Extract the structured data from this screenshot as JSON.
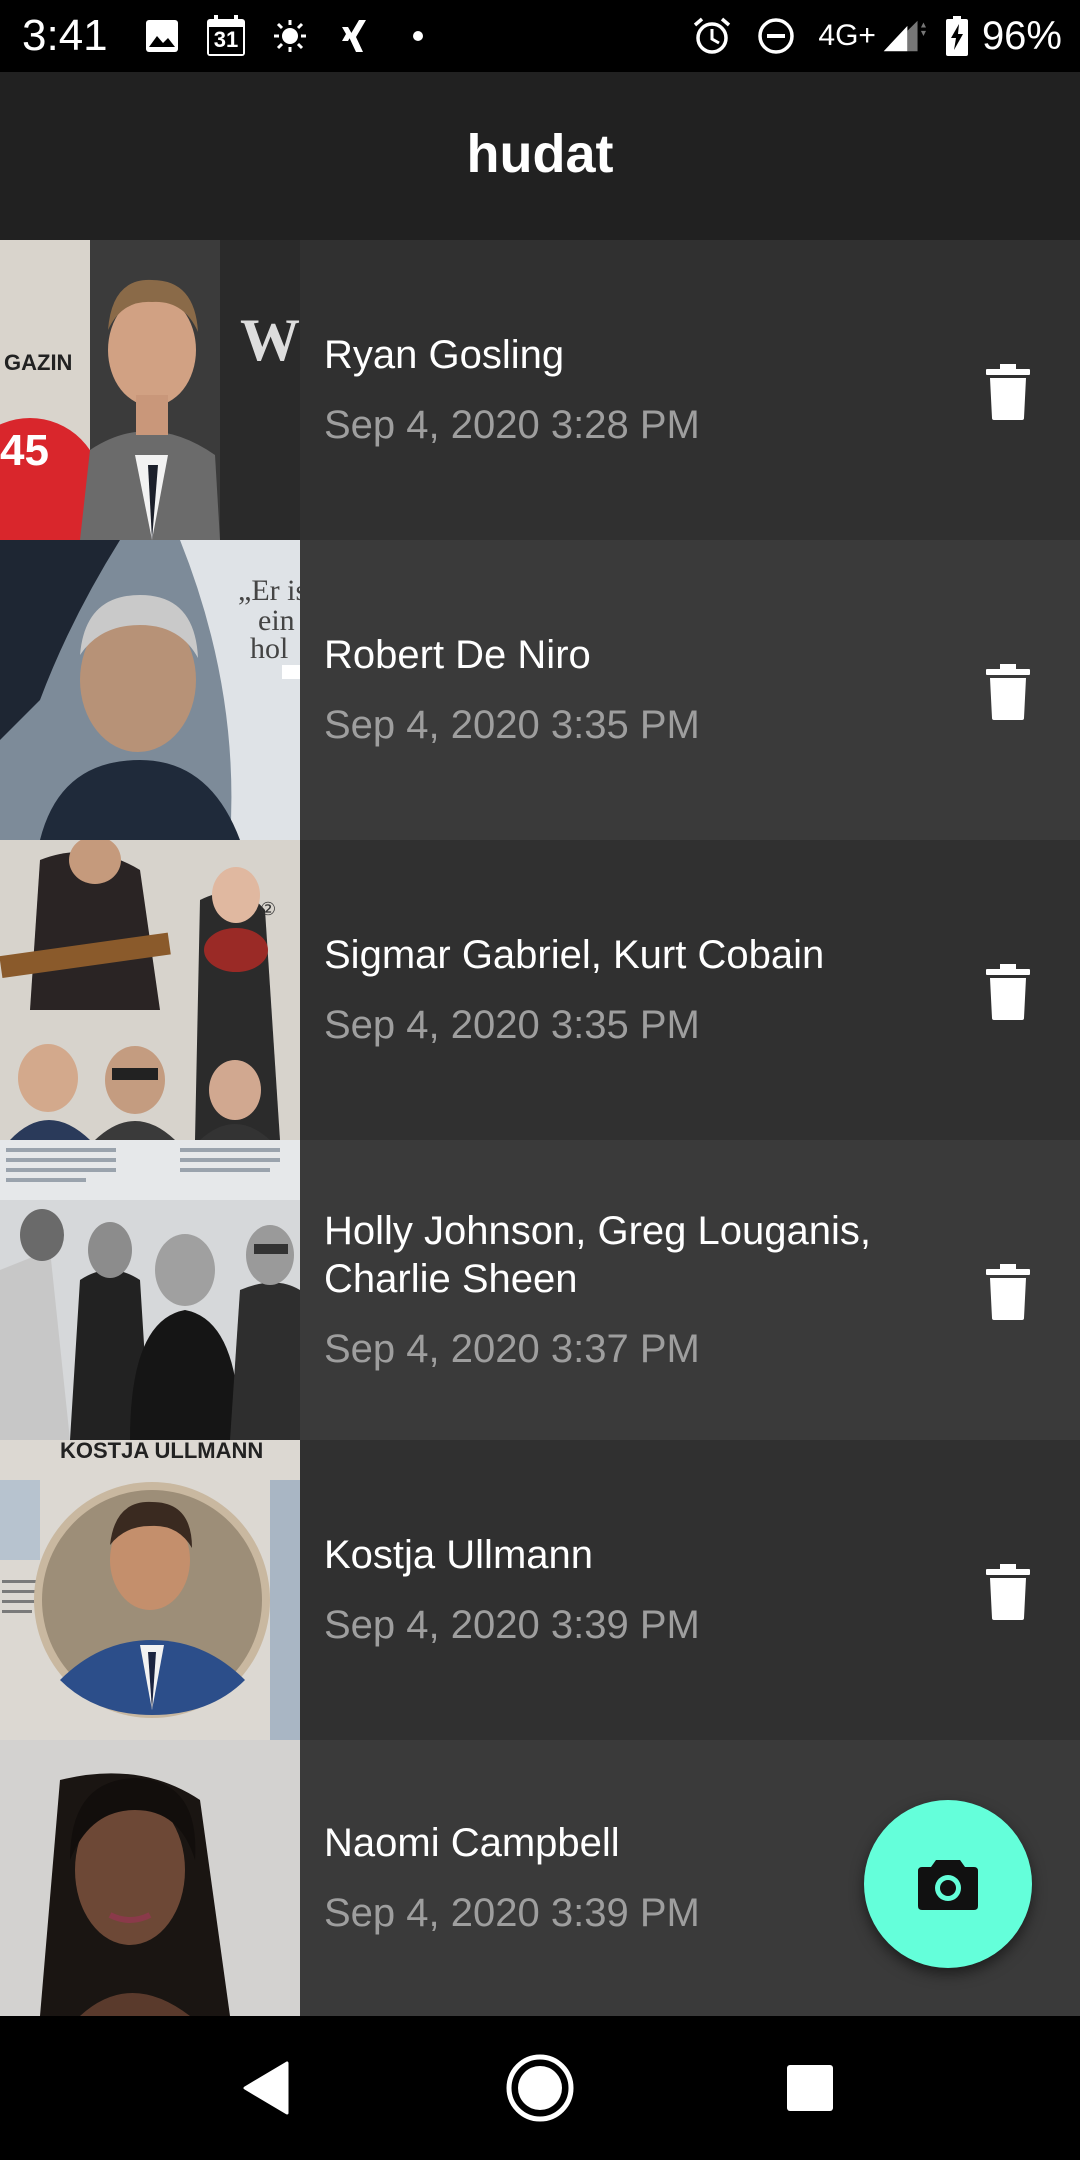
{
  "status_bar": {
    "time": "3:41",
    "left_icons": [
      "image-icon",
      "calendar-icon",
      "brightness-icon",
      "xing-icon",
      "dot-icon"
    ],
    "calendar_day": "31",
    "right_icons": [
      "alarm-icon",
      "do-not-disturb-icon",
      "signal-icon",
      "battery-charging-icon"
    ],
    "network": "4G+",
    "battery": "96%"
  },
  "app_bar": {
    "title": "hudat"
  },
  "items": [
    {
      "name": "Ryan Gosling",
      "date": "Sep 4, 2020 3:28 PM"
    },
    {
      "name": "Robert De Niro",
      "date": "Sep 4, 2020 3:35 PM"
    },
    {
      "name": "Sigmar Gabriel, Kurt Cobain",
      "date": "Sep 4, 2020 3:35 PM"
    },
    {
      "name": "Holly Johnson, Greg Louganis, Charlie Sheen",
      "date": "Sep 4, 2020 3:37 PM"
    },
    {
      "name": "Kostja Ullmann",
      "date": "Sep 4, 2020 3:39 PM"
    },
    {
      "name": "Naomi Campbell",
      "date": "Sep 4, 2020 3:39 PM"
    }
  ],
  "fab": {
    "icon": "camera-icon"
  },
  "colors": {
    "accent": "#64ffda",
    "app_bar": "#212121",
    "row_dark": "#303030",
    "row_light": "#3a3a3a",
    "secondary_text": "#9e9e9e"
  },
  "nav_bar": {
    "buttons": [
      "back-icon",
      "home-icon",
      "recents-icon"
    ]
  }
}
